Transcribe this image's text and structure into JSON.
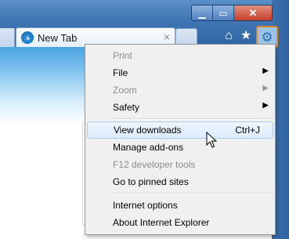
{
  "window": {
    "controls": {
      "minimize": "▁",
      "maximize": "▭",
      "close": "✕"
    }
  },
  "tab": {
    "title": "New Tab",
    "close_glyph": "×"
  },
  "toolbar": {
    "home_icon": "⌂",
    "favorites_icon": "★",
    "tools_icon": "⚙"
  },
  "menu": {
    "print": "Print",
    "file": "File",
    "zoom": "Zoom",
    "safety": "Safety",
    "view_downloads": "View downloads",
    "view_downloads_shortcut": "Ctrl+J",
    "manage_addons": "Manage add-ons",
    "f12_tools": "F12 developer tools",
    "pinned_sites": "Go to pinned sites",
    "internet_options": "Internet options",
    "about": "About Internet Explorer",
    "submenu_arrow": "▶"
  },
  "colors": {
    "tools_highlight": "#e0862a",
    "menu_highlight": "#dcebfb"
  }
}
